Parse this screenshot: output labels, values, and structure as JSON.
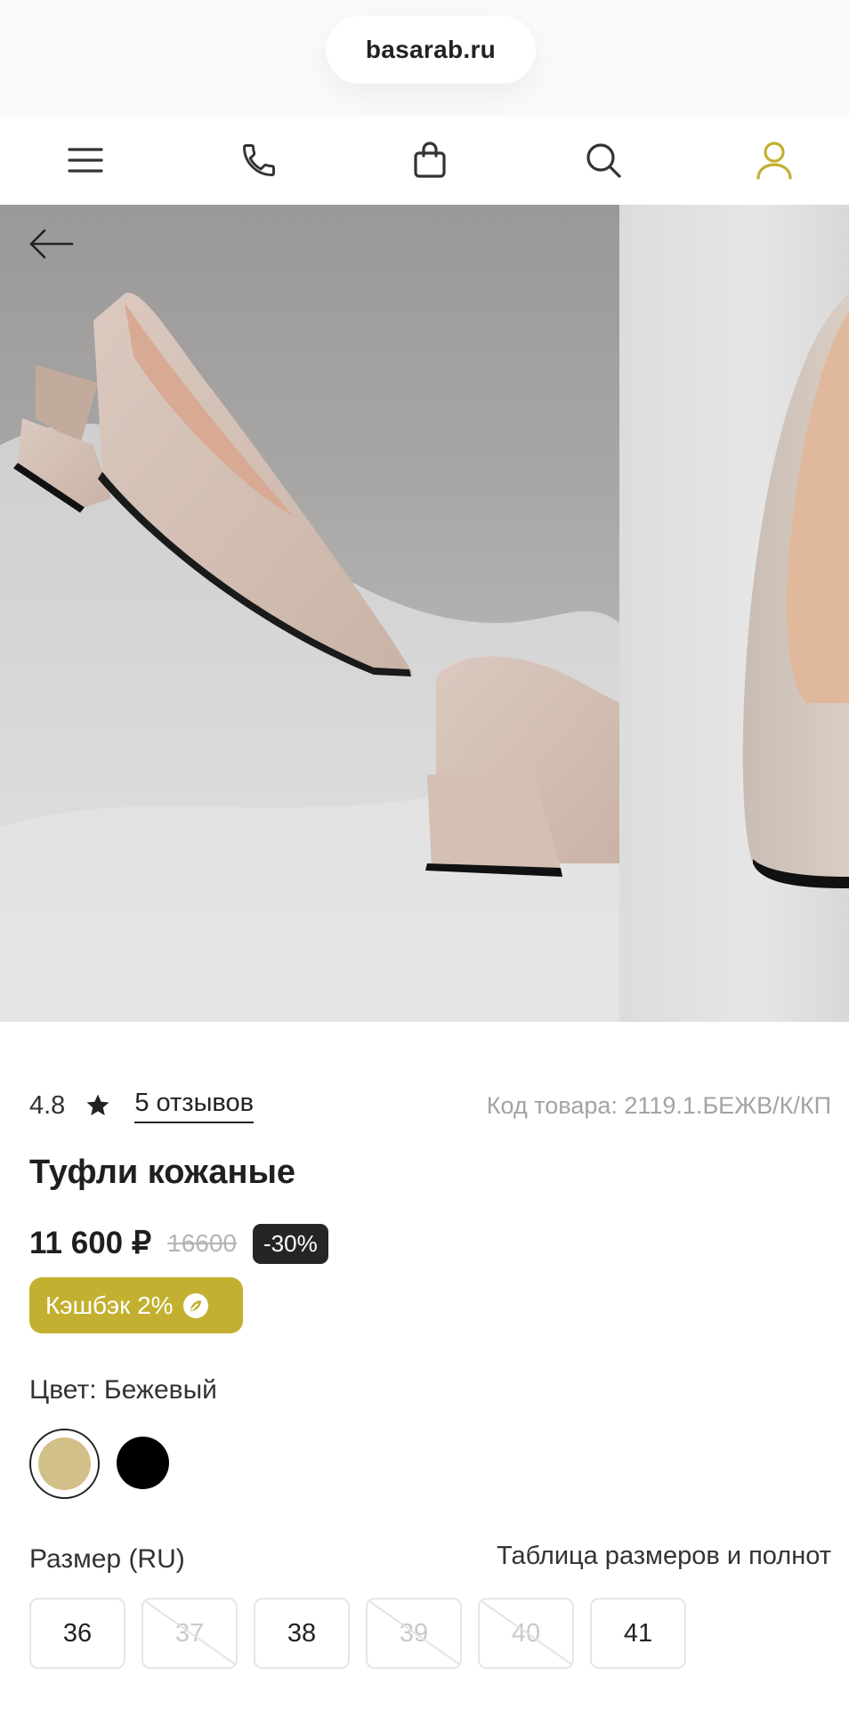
{
  "browser": {
    "url": "basarab.ru"
  },
  "nav": {
    "icons": [
      "menu-icon",
      "phone-icon",
      "bag-icon",
      "search-icon",
      "user-icon"
    ],
    "accent_color": "#c3b031"
  },
  "product": {
    "rating": "4.8",
    "reviews_link": "5 отзывов",
    "sku": "Код товара: 2119.1.БЕЖВ/К/КП",
    "title": "Туфли кожаные",
    "price": "11 600 ₽",
    "old_price": "16600",
    "discount": "-30%",
    "cashback": "Кэшбэк 2%",
    "color_label": "Цвет: Бежевый",
    "colors": [
      "#d2c088",
      "#000000"
    ],
    "size_label": "Размер (RU)",
    "size_table_link": "Таблица размеров и полнот",
    "sizes": [
      {
        "label": "36",
        "available": true
      },
      {
        "label": "37",
        "available": false
      },
      {
        "label": "38",
        "available": true
      },
      {
        "label": "39",
        "available": false
      },
      {
        "label": "40",
        "available": false
      },
      {
        "label": "41",
        "available": true
      }
    ]
  }
}
